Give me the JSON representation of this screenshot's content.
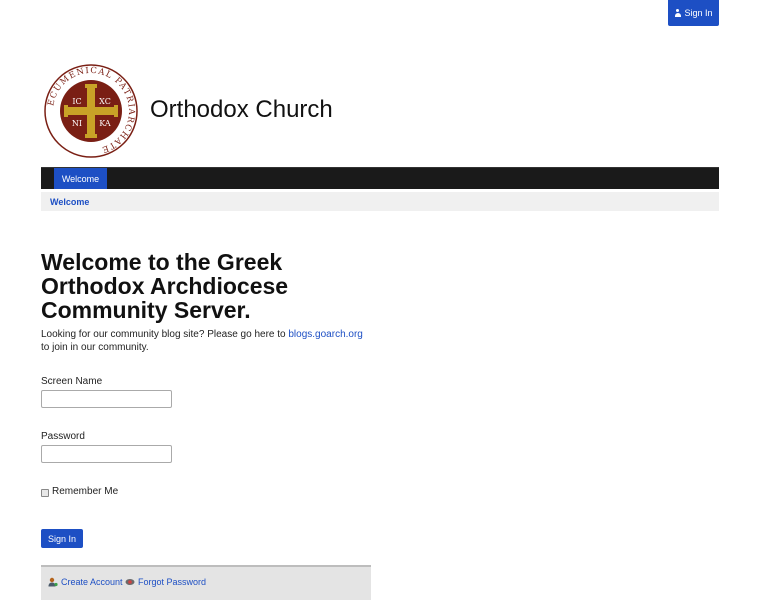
{
  "header": {
    "signin_label": "Sign In",
    "site_title": "Orthodox Church",
    "logo_text": "ECUMENICAL PATRIARCHATE",
    "logo_monograms": [
      "IC",
      "XC",
      "NI",
      "KA"
    ]
  },
  "nav": {
    "tabs": [
      {
        "label": "Welcome"
      }
    ]
  },
  "breadcrumb": {
    "label": "Welcome"
  },
  "main": {
    "heading": "Welcome to the Greek Orthodox Archdiocese Community Server.",
    "intro_before": "Looking for our community blog site? Please go here to",
    "intro_link": "blogs.goarch.org",
    "intro_after": "to join in our community."
  },
  "form": {
    "screen_name_label": "Screen Name",
    "screen_name_value": "",
    "password_label": "Password",
    "password_value": "",
    "remember_label": "Remember Me",
    "remember_checked": false,
    "submit_label": "Sign In"
  },
  "footer": {
    "create_account_label": "Create Account",
    "forgot_password_label": "Forgot Password"
  },
  "colors": {
    "accent": "#1d4fc4",
    "navbar": "#1a1a1a",
    "logo_red": "#7a1f14",
    "logo_gold": "#c9a227"
  },
  "icons": [
    "user-icon",
    "create-account-icon",
    "forgot-password-icon"
  ]
}
